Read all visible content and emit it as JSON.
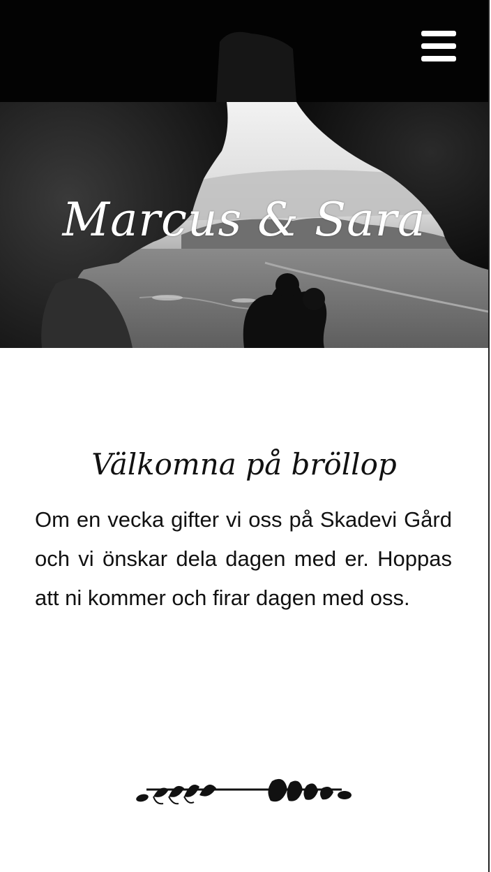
{
  "header": {
    "menu_icon": "hamburger-menu-icon"
  },
  "hero": {
    "title": "Marcus & Sara"
  },
  "welcome": {
    "heading": "Välkomna på bröllop",
    "body": "Om en vecka gifter vi oss på Skadevi Gård och vi önskar dela dagen med er. Hoppas att ni kommer och firar da­gen med oss."
  },
  "decoration": {
    "icon": "laurel-branch-divider-icon"
  }
}
